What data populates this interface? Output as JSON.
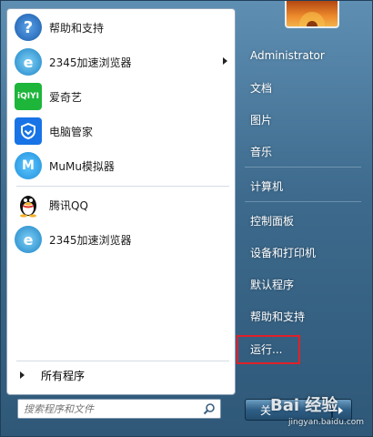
{
  "pinned": [
    {
      "label": "帮助和支持",
      "icon": "help-icon",
      "has_arrow": false
    },
    {
      "label": "2345加速浏览器",
      "icon": "browser-2345-icon",
      "has_arrow": true
    },
    {
      "label": "爱奇艺",
      "icon": "iqiyi-icon",
      "has_arrow": false
    },
    {
      "label": "电脑管家",
      "icon": "pc-manager-icon",
      "has_arrow": false
    },
    {
      "label": "MuMu模拟器",
      "icon": "mumu-icon",
      "has_arrow": false
    },
    {
      "label": "腾讯QQ",
      "icon": "qq-icon",
      "has_arrow": false
    },
    {
      "label": "2345加速浏览器",
      "icon": "browser-2345-icon",
      "has_arrow": false
    }
  ],
  "all_programs": "所有程序",
  "search": {
    "placeholder": "搜索程序和文件"
  },
  "right": {
    "user": "Administrator",
    "items": [
      "文档",
      "图片",
      "音乐",
      "计算机",
      "控制面板",
      "设备和打印机",
      "默认程序",
      "帮助和支持",
      "运行..."
    ]
  },
  "shutdown": {
    "label": "关"
  },
  "watermark": {
    "text": "Bai 经验",
    "sub": "jingyan.baidu.com"
  },
  "colors": {
    "highlight": "#e0202a",
    "accent": "#3d6a8d"
  }
}
